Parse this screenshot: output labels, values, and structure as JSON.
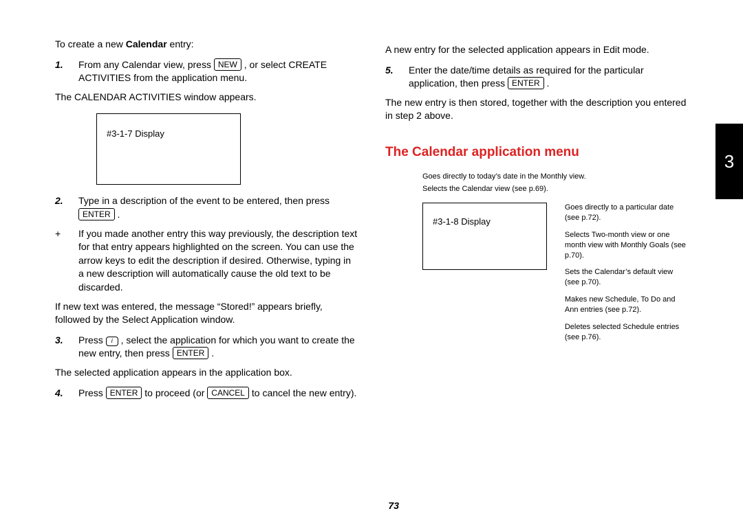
{
  "left": {
    "intro_pre": "To create a new ",
    "intro_bold": "Calendar",
    "intro_post": " entry:",
    "step1_num": "1.",
    "step1_a": "From any Calendar view, press ",
    "step1_key": "NEW",
    "step1_b": " , or select CREATE ACTIVITIES from the application menu.",
    "after1": "The CALENDAR ACTIVITIES window appears.",
    "display1": "#3-1-7 Display",
    "step2_num": "2.",
    "step2_a": "Type in a description of the event to be entered, then press ",
    "step2_key": "ENTER",
    "step2_b": " .",
    "plus_mark": "+",
    "plus_text": "If you made another entry this way previously, the description text for that entry appears highlighted on the screen. You can use the arrow keys to edit the description if desired. Otherwise, typing in a new description will automatically cause the old text to be discarded.",
    "after2": "If new text was entered, the message “Stored!” appears briefly, followed by the Select Application window.",
    "step3_num": "3.",
    "step3_a": "Press ",
    "step3_key1": "i",
    "step3_b": " , select the application for which you want to create the new entry, then press ",
    "step3_key2": "ENTER",
    "step3_c": " .",
    "after3": "The selected application appears in the application box.",
    "step4_num": "4.",
    "step4_a": "Press ",
    "step4_key1": "ENTER",
    "step4_b": " to proceed (or ",
    "step4_key2": "CANCEL",
    "step4_c": " to cancel the new entry)."
  },
  "right": {
    "top_para": "A new entry for the selected application appears in Edit mode.",
    "step5_num": "5.",
    "step5_a": "Enter the date/time details as required for the particular application, then press ",
    "step5_key": "ENTER",
    "step5_b": " .",
    "after5": "The new entry is then stored, together with the description you entered in step 2 above.",
    "heading": "The Calendar application menu",
    "annot_top1": "Goes directly to today’s date in the Monthly view.",
    "annot_top2": "Selects the Calendar view (see p.69).",
    "display2": "#3-1-8 Display",
    "annot_r1": "Goes directly to a particular date (see p.72).",
    "annot_r2": "Selects Two-month view or one month view with Monthly Goals (see p.70).",
    "annot_r3": "Sets the Calendar’s default view (see p.70).",
    "annot_r4": "Makes new Schedule, To Do and Ann entries (see p.72).",
    "annot_r5": "Deletes selected Schedule entries (see p.76)."
  },
  "chapter_tab": "3",
  "page_number": "73"
}
